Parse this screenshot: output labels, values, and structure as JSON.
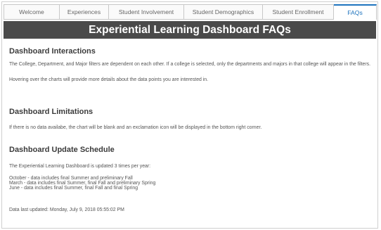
{
  "tabs": [
    {
      "label": "Welcome",
      "active": false
    },
    {
      "label": "Experiences",
      "active": false
    },
    {
      "label": "Student Involvement",
      "active": false
    },
    {
      "label": "Student Demographics",
      "active": false
    },
    {
      "label": "Student Enrollment",
      "active": false
    },
    {
      "label": "FAQs",
      "active": true
    }
  ],
  "banner": {
    "title": "Experiential Learning Dashboard FAQs"
  },
  "sections": {
    "interactions": {
      "heading": "Dashboard Interactions",
      "p1": "The College, Department, and Major filters are dependent on each other. If a college is selected, only the departments and majors in that college will appear in the filters.",
      "p2": "Hovering over the charts will provide more details about the data points you are interested in."
    },
    "limitations": {
      "heading": "Dashboard Limitations",
      "p1": "If there is no data availabe, the chart will be blank and an exclamation icon will be displayed in the bottom right corner."
    },
    "schedule": {
      "heading": "Dashboard Update Schedule",
      "intro": "The Experiential Learning Dashboard is updated 3 times per year:",
      "items": [
        "October - data includes final Summer and preliminary Fall",
        "March - data includes final Summer, final Fall and preliminary Spring",
        "June - data includes final Summer, final Fall and final Spring"
      ],
      "last_updated": "Data last updated: Monday, July 9, 2018 05:55:02 PM"
    }
  },
  "colors": {
    "banner_bg": "#4a4a4a",
    "active_tab": "#1e73be"
  }
}
